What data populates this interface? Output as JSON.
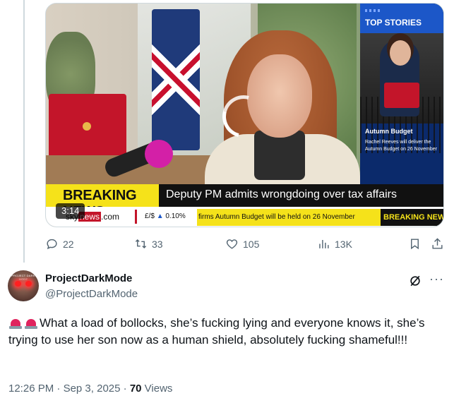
{
  "video": {
    "duration": "3:14",
    "breaking_label": "BREAKING NEWS",
    "headline": "Deputy PM admits wrongdoing over tax affairs",
    "top_stories": {
      "header": "TOP STORIES",
      "title": "Autumn Budget",
      "description": "Rachel Reeves will deliver the Autumn Budget on 26 November"
    },
    "ticker": {
      "site_prefix": "sky",
      "site_news": "news",
      "site_suffix": ".com",
      "fx_label": "£/$",
      "fx_change": "0.10%",
      "scroll_text": "firms Autumn Budget will be held on 26 November",
      "breaking_label": "BREAKING NEWS"
    }
  },
  "actions": {
    "replies": "22",
    "reposts": "33",
    "likes": "105",
    "views": "13K"
  },
  "tweet": {
    "display_name": "ProjectDarkMode",
    "handle": "@ProjectDarkMode",
    "avatar_text": "PROJECT DARK MODE",
    "text": "What a load of bollocks, she’s fucking lying and everyone knows it, she’s trying to use her son now as a human shield, absolutely fucking shameful!!!",
    "time": "12:26 PM",
    "date": "Sep 3, 2025",
    "view_count": "70",
    "views_label": "Views"
  },
  "colors": {
    "breaking_yellow": "#f5e21a",
    "sky_blue": "#1c57c8",
    "sky_red": "#c3152a",
    "secondary_text": "#536471"
  }
}
